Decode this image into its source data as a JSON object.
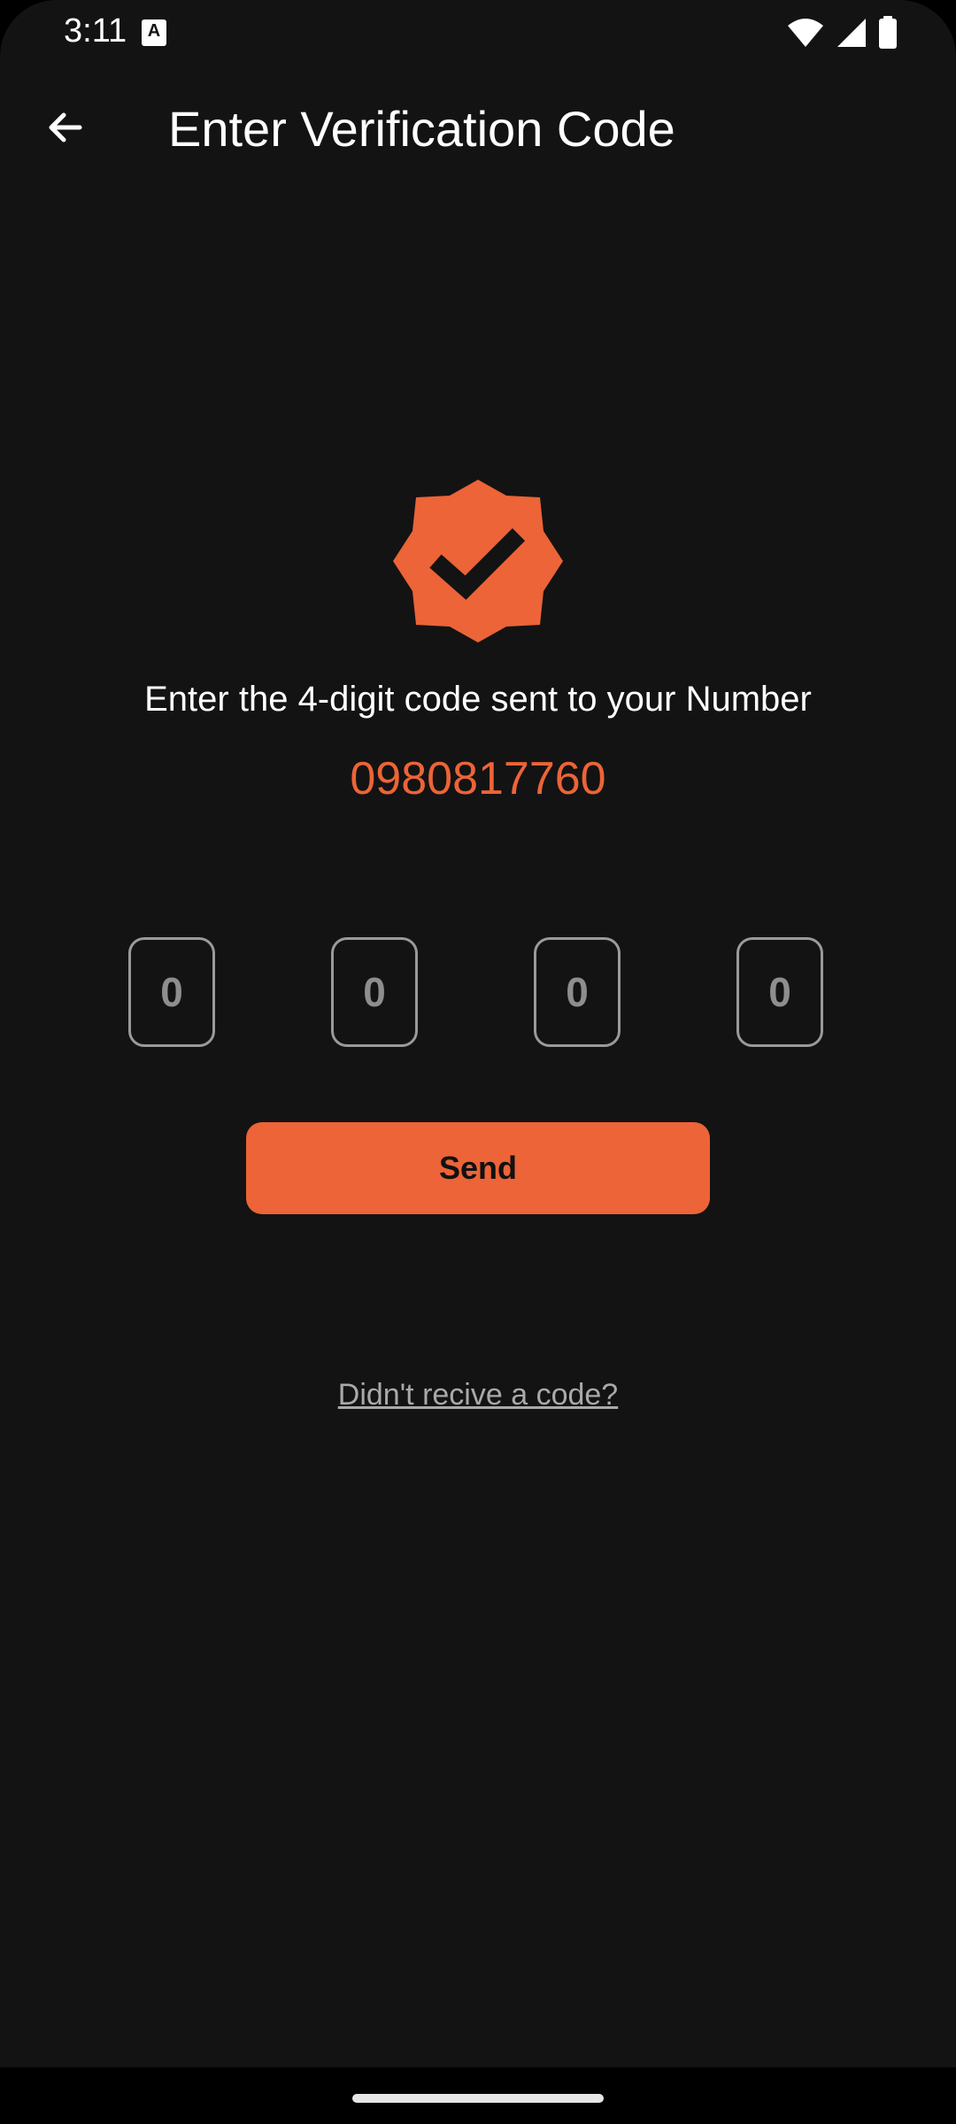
{
  "status_bar": {
    "time": "3:11",
    "notification_icon": "a-icon",
    "icons": [
      "wifi-icon",
      "signal-icon",
      "battery-icon"
    ]
  },
  "app_bar": {
    "back_icon": "arrow-left-icon",
    "title": "Enter Verification Code"
  },
  "verification": {
    "badge_icon": "verified-badge-icon",
    "instruction": "Enter the 4-digit code sent to your Number",
    "phone_number": "0980817760",
    "code_digits": [
      "0",
      "0",
      "0",
      "0"
    ],
    "send_label": "Send",
    "resend_link": "Didn't recive a code?"
  },
  "colors": {
    "accent": "#ec6437",
    "background": "#131313",
    "text": "#ffffff",
    "muted": "#a9a9a9"
  }
}
